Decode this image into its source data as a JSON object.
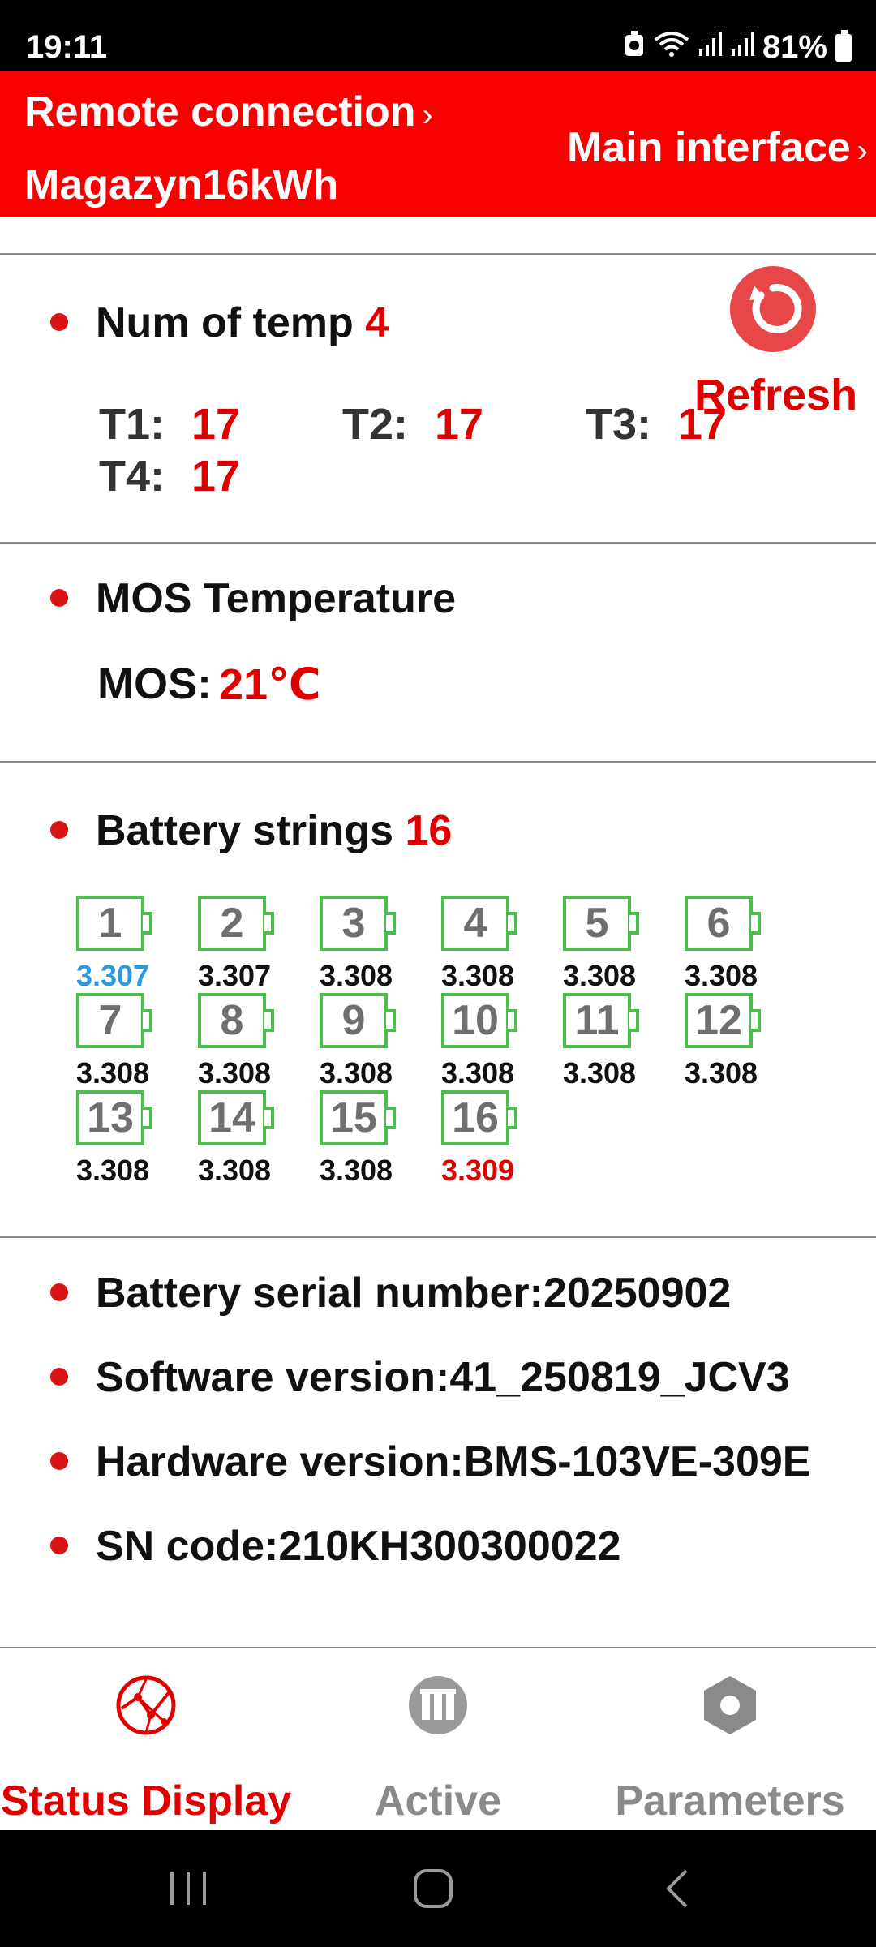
{
  "status_bar": {
    "time": "19:11",
    "battery_percent": "81%"
  },
  "header": {
    "remote_label": "Remote connection",
    "device_name": "Magazyn16kWh",
    "main_interface_label": "Main interface",
    "color": "#f60000"
  },
  "temp_section": {
    "title": "Num of temp",
    "count": "4",
    "sensors": [
      {
        "label": "T1:",
        "value": "17"
      },
      {
        "label": "T2:",
        "value": "17"
      },
      {
        "label": "T3:",
        "value": "17"
      },
      {
        "label": "T4:",
        "value": "17"
      }
    ],
    "refresh_label": "Refresh"
  },
  "mos_section": {
    "title": "MOS Temperature",
    "label": "MOS:",
    "value": "21℃"
  },
  "battery_section": {
    "title": "Battery strings",
    "count": "16",
    "cells": [
      {
        "num": "1",
        "volt": "3.307",
        "state": "low"
      },
      {
        "num": "2",
        "volt": "3.307",
        "state": "normal"
      },
      {
        "num": "3",
        "volt": "3.308",
        "state": "normal"
      },
      {
        "num": "4",
        "volt": "3.308",
        "state": "normal"
      },
      {
        "num": "5",
        "volt": "3.308",
        "state": "normal"
      },
      {
        "num": "6",
        "volt": "3.308",
        "state": "normal"
      },
      {
        "num": "7",
        "volt": "3.308",
        "state": "normal"
      },
      {
        "num": "8",
        "volt": "3.308",
        "state": "normal"
      },
      {
        "num": "9",
        "volt": "3.308",
        "state": "normal"
      },
      {
        "num": "10",
        "volt": "3.308",
        "state": "normal"
      },
      {
        "num": "11",
        "volt": "3.308",
        "state": "normal"
      },
      {
        "num": "12",
        "volt": "3.308",
        "state": "normal"
      },
      {
        "num": "13",
        "volt": "3.308",
        "state": "normal"
      },
      {
        "num": "14",
        "volt": "3.308",
        "state": "normal"
      },
      {
        "num": "15",
        "volt": "3.308",
        "state": "normal"
      },
      {
        "num": "16",
        "volt": "3.309",
        "state": "high"
      }
    ]
  },
  "info_section": {
    "serial": "Battery serial number:20250902",
    "software": "Software version:41_250819_JCV3",
    "hardware": "Hardware version:BMS-103VE-309E",
    "sn_code": "SN code:210KH300300022"
  },
  "bottom_nav": {
    "items": [
      {
        "label": "Status Display",
        "icon": "status-display-icon",
        "active": true
      },
      {
        "label": "Active",
        "icon": "active-icon",
        "active": false
      },
      {
        "label": "Parameters",
        "icon": "parameters-icon",
        "active": false
      }
    ],
    "active_color": "#e10000",
    "inactive_color": "#8a8a8a"
  },
  "system_nav": {
    "buttons": [
      "recents-icon",
      "home-icon",
      "back-icon"
    ]
  }
}
